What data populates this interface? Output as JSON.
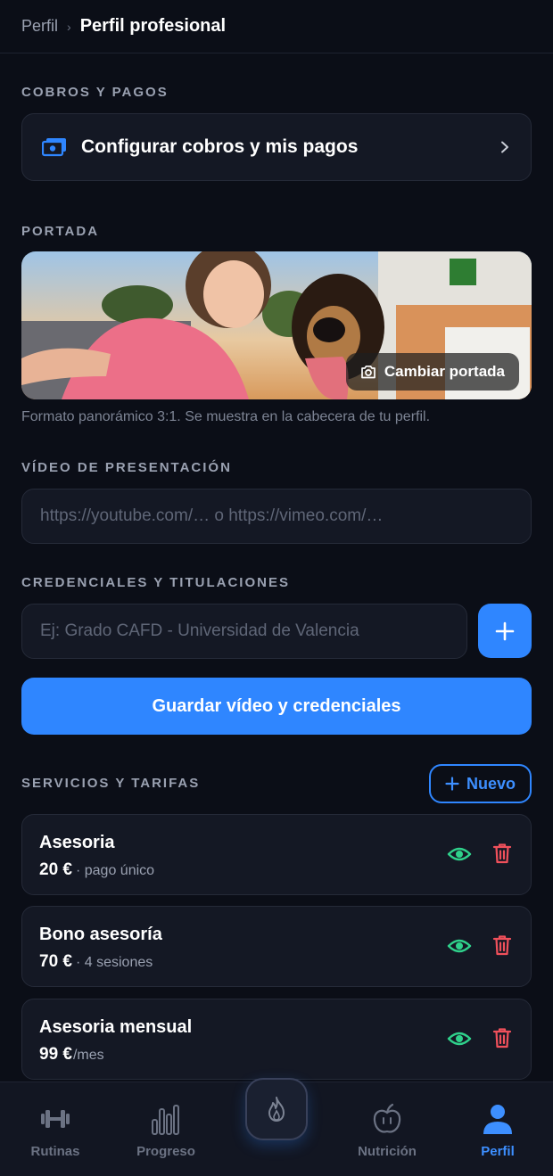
{
  "breadcrumb": {
    "parent": "Perfil",
    "separator": "›",
    "current": "Perfil profesional"
  },
  "payments": {
    "section_label": "COBROS Y PAGOS",
    "item_label": "Configurar cobros y mis pagos",
    "icon": "money-icon"
  },
  "cover": {
    "section_label": "PORTADA",
    "change_label": "Cambiar portada",
    "hint": "Formato panorámico 3:1. Se muestra en la cabecera de tu perfil."
  },
  "video": {
    "section_label": "VÍDEO DE PRESENTACIÓN",
    "placeholder": "https://youtube.com/…  o  https://vimeo.com/…"
  },
  "credentials": {
    "section_label": "CREDENCIALES Y TITULACIONES",
    "placeholder": "Ej: Grado CAFD - Universidad de Valencia",
    "save_label": "Guardar vídeo y credenciales"
  },
  "services": {
    "section_label": "SERVICIOS Y TARIFAS",
    "new_label": "Nuevo",
    "items": [
      {
        "name": "Asesoria",
        "price": "20 €",
        "detail": "· pago único"
      },
      {
        "name": "Bono asesoría",
        "price": "70 €",
        "detail": "· 4 sesiones"
      },
      {
        "name": "Asesoria mensual",
        "price": "99 €",
        "detail": "/mes"
      }
    ]
  },
  "nav": {
    "items": [
      {
        "label": "Rutinas",
        "icon": "dumbbell-icon"
      },
      {
        "label": "Progreso",
        "icon": "bars-icon"
      },
      {
        "label": "",
        "icon": "flame-icon"
      },
      {
        "label": "Nutrición",
        "icon": "apple-icon"
      },
      {
        "label": "Perfil",
        "icon": "user-icon",
        "active": true
      }
    ]
  },
  "colors": {
    "background": "#0b0e17",
    "accent": "#2f86ff",
    "eye": "#2fd18b",
    "trash": "#f0505b"
  }
}
